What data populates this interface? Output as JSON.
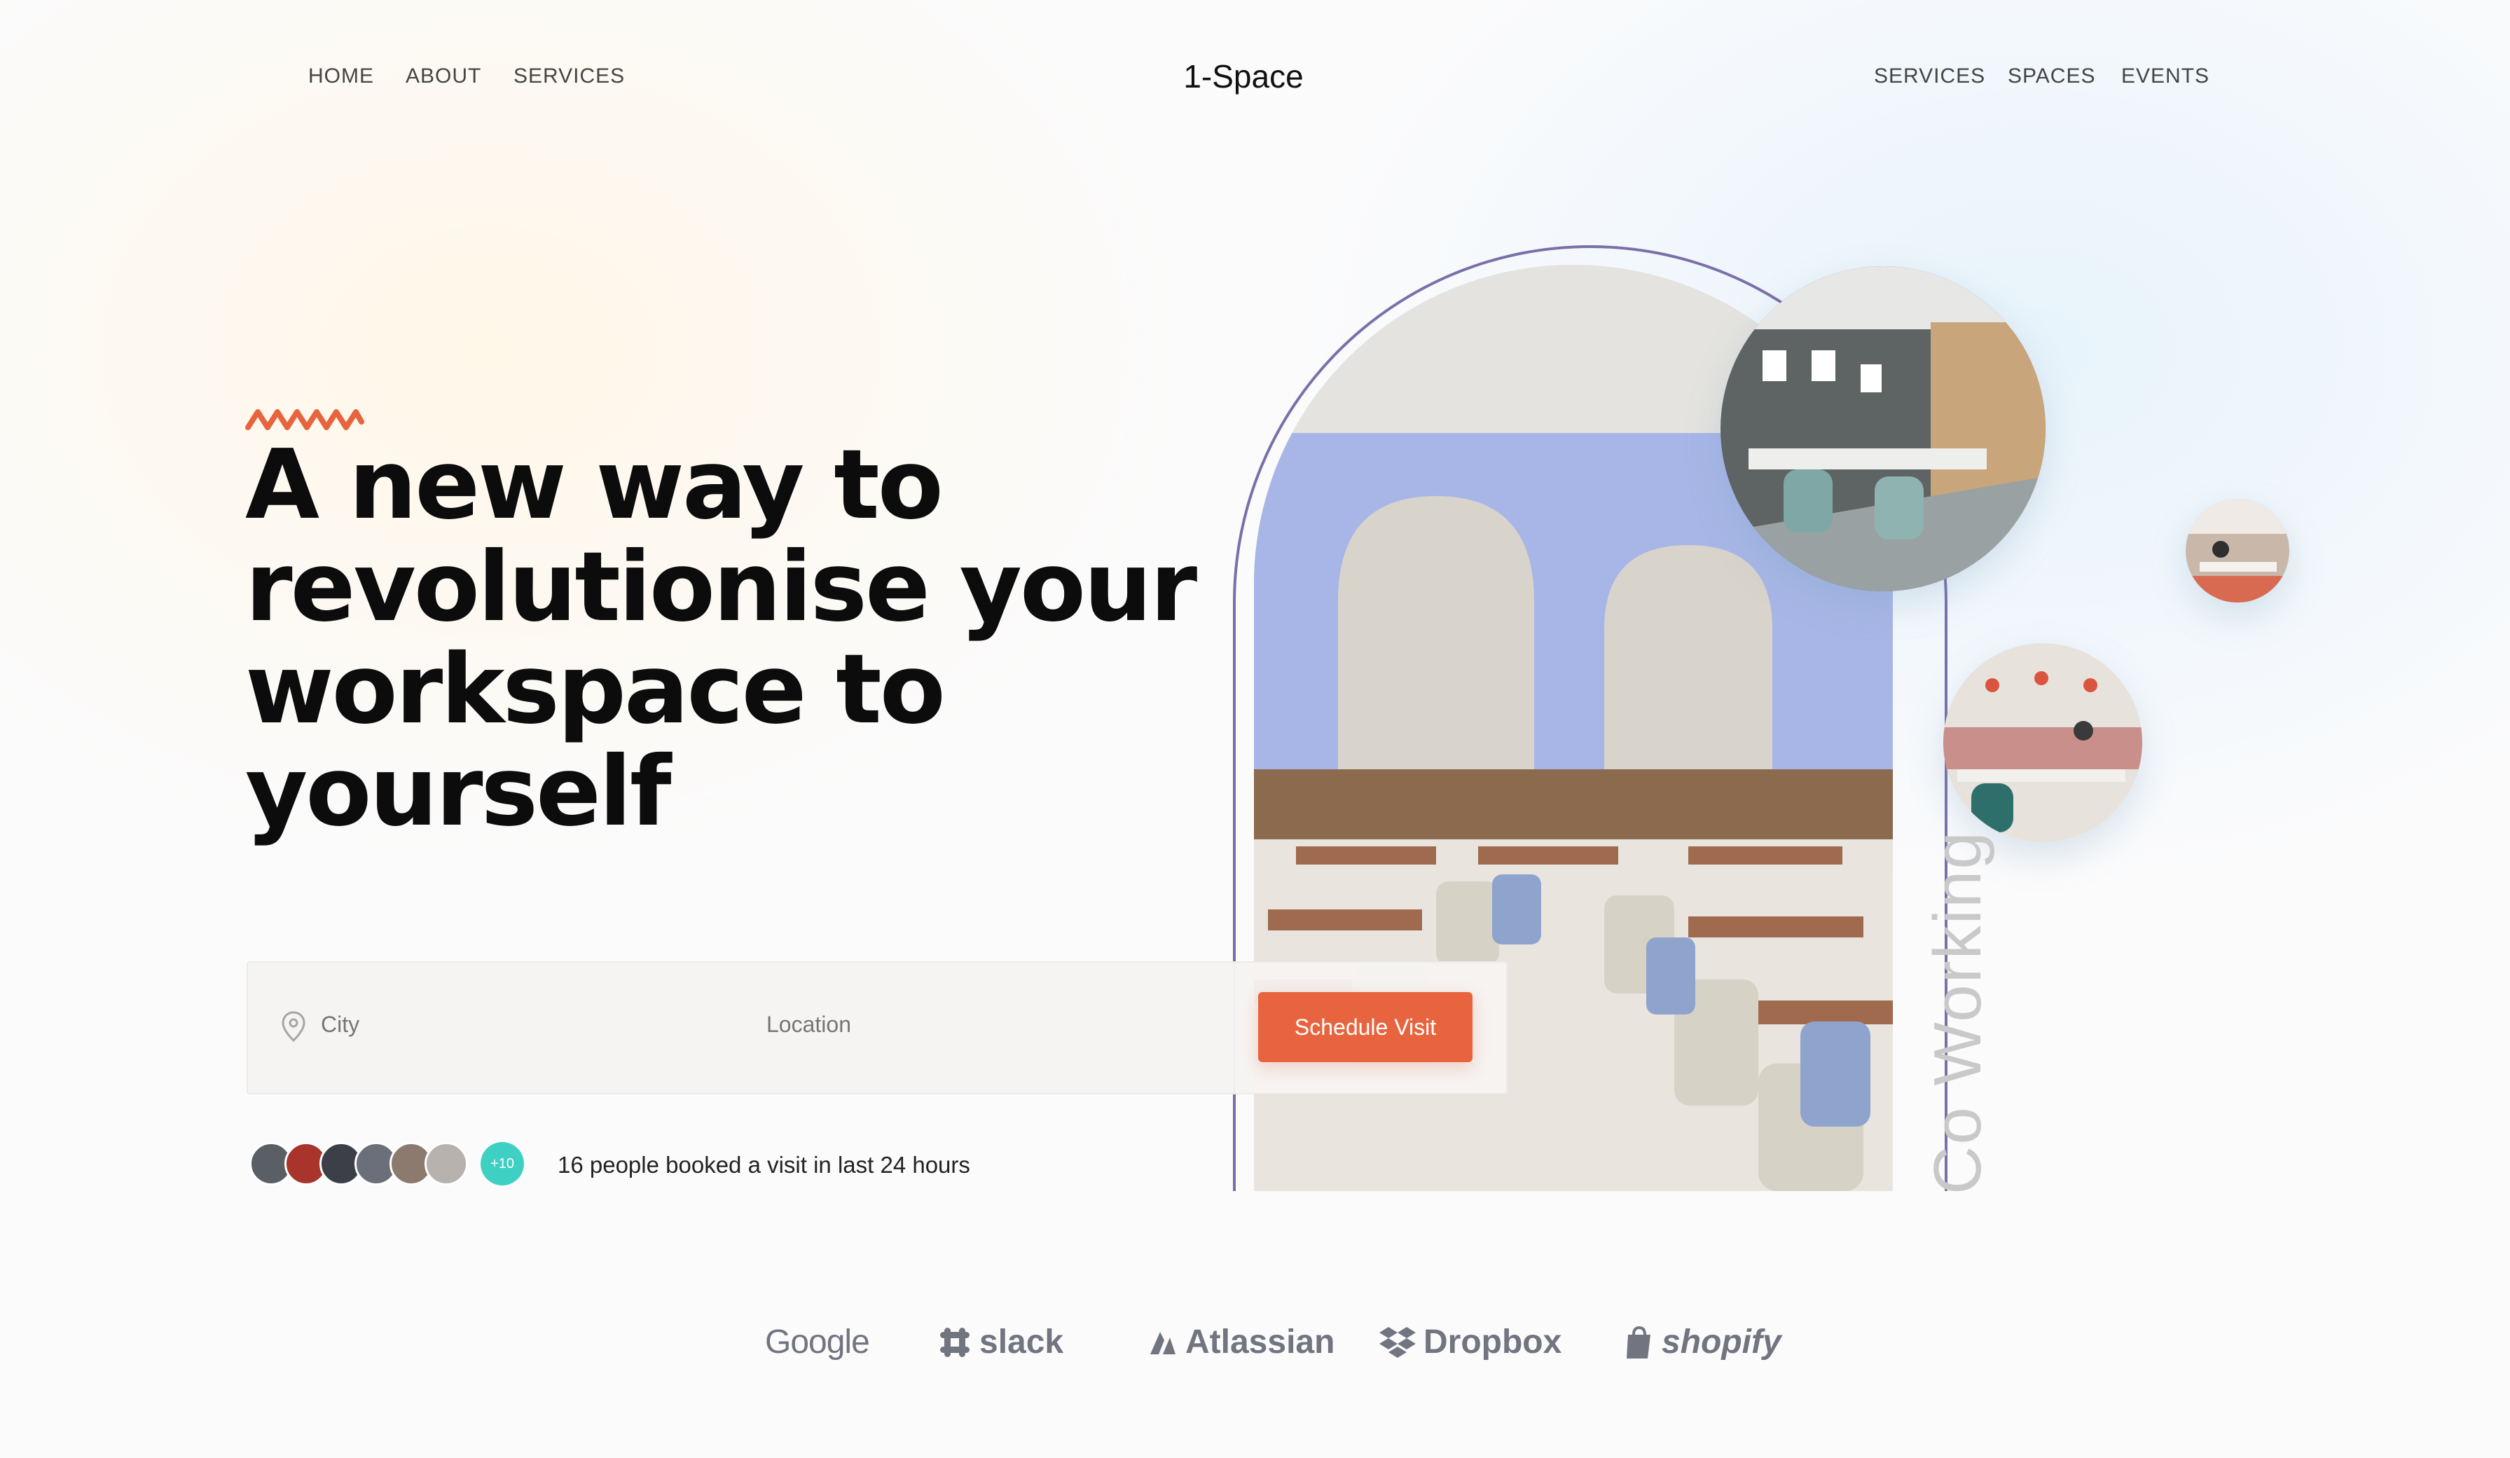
{
  "nav": {
    "left": [
      "HOME",
      "ABOUT",
      "SERVICES"
    ],
    "brand": "1-Space",
    "right": [
      "SERVICES",
      "SPACES",
      "EVENTS"
    ]
  },
  "hero": {
    "headline": "A new way to revolutionise your workspace to yourself",
    "accent_color": "#e8643e"
  },
  "search": {
    "city_placeholder": "City",
    "location_placeholder": "Location",
    "cta_label": "Schedule Visit"
  },
  "social_proof": {
    "more_badge": "+10",
    "text": "16 people booked a visit in last 24 hours"
  },
  "imagery": {
    "vertical_label": "Co Working"
  },
  "partners": [
    "Google",
    "slack",
    "Atlassian",
    "Dropbox",
    "shopify"
  ]
}
